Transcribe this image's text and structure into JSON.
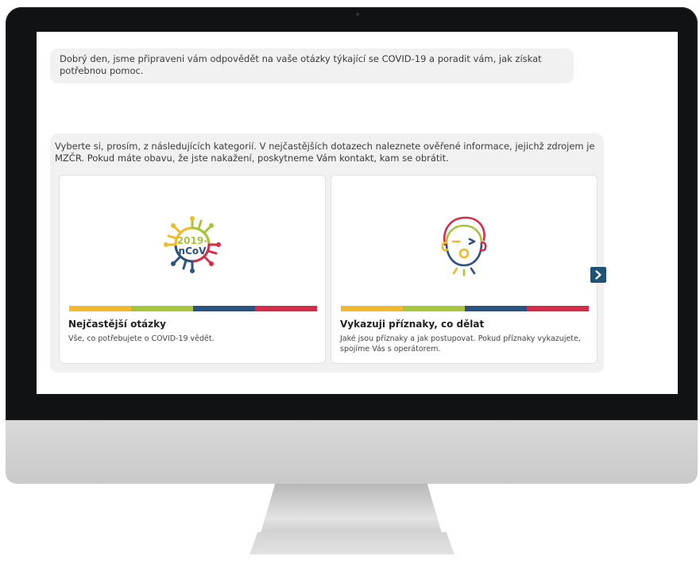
{
  "chat": {
    "greeting": "Dobrý den, jsme připraveni vám odpovědět na vaše otázky týkající se COVID-19 a poradit vám, jak získat potřebnou pomoc.",
    "categories_intro": "Vyberte si, prosím, z následujících kategorií. V nejčastějších dotazech naleznete ověřené informace, jejichž zdrojem je MZČR. Pokud máte obavu, že jste nakažení, poskytneme Vám kontakt, kam se obrátit.",
    "cards": [
      {
        "icon": "virus-icon",
        "icon_text_top": "2019-",
        "icon_text_bottom": "nCoV",
        "title": "Nejčastější otázky",
        "description": "Vše, co potřebujete o COVID-19 vědět."
      },
      {
        "icon": "sick-person-icon",
        "title": "Vykazuji příznaky, co dělat",
        "description": "Jaké jsou příznaky a jak postupovat. Pokud příznaky vykazujete, spojíme Vás s operátorem."
      }
    ],
    "next_icon": "chevron-right-icon"
  },
  "colors": {
    "stripe": [
      "#f2b92b",
      "#a8c43c",
      "#2c5282",
      "#d62b4a"
    ],
    "next_button": "#1f5376",
    "bubble_bg": "#f1f1f1"
  }
}
